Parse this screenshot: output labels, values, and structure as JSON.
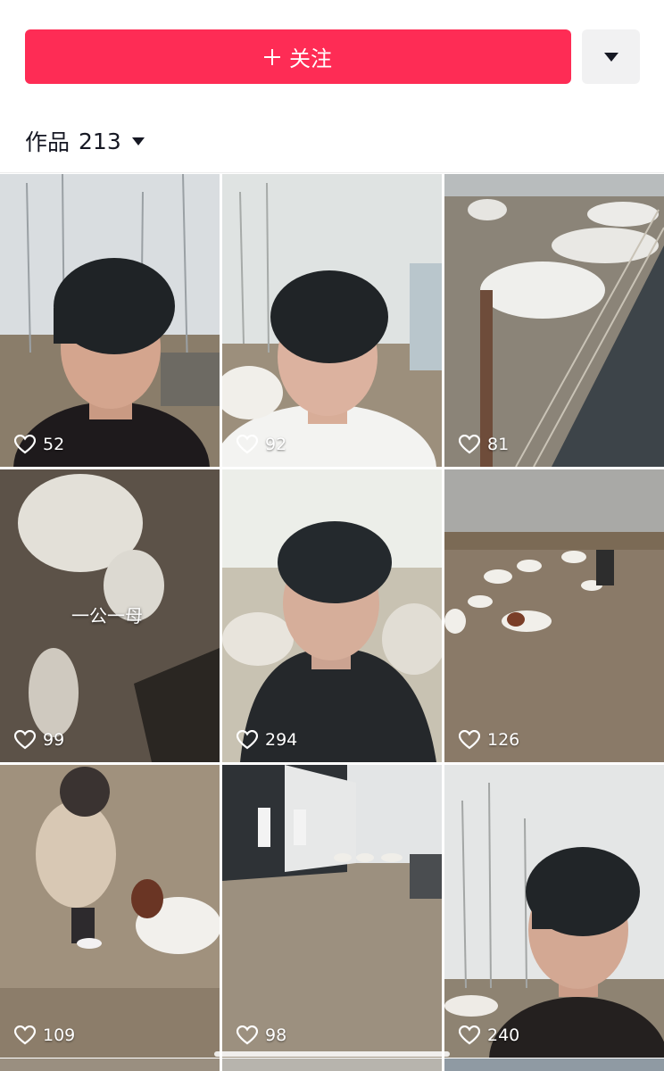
{
  "header": {
    "follow_label": "关注",
    "works_label": "作品",
    "works_count": "213"
  },
  "colors": {
    "accent": "#fe2c55",
    "secondary_button": "#f1f1f2",
    "text": "#161823"
  },
  "icons": {
    "follow": "plus-icon",
    "more": "triangle-down-icon",
    "likes": "heart-outline-icon"
  },
  "videos": [
    {
      "likes": "52"
    },
    {
      "likes": "92"
    },
    {
      "likes": "81"
    },
    {
      "likes": "99",
      "overlay_text": "一公一母"
    },
    {
      "likes": "294"
    },
    {
      "likes": "126"
    },
    {
      "likes": "109"
    },
    {
      "likes": "98"
    },
    {
      "likes": "240"
    }
  ]
}
